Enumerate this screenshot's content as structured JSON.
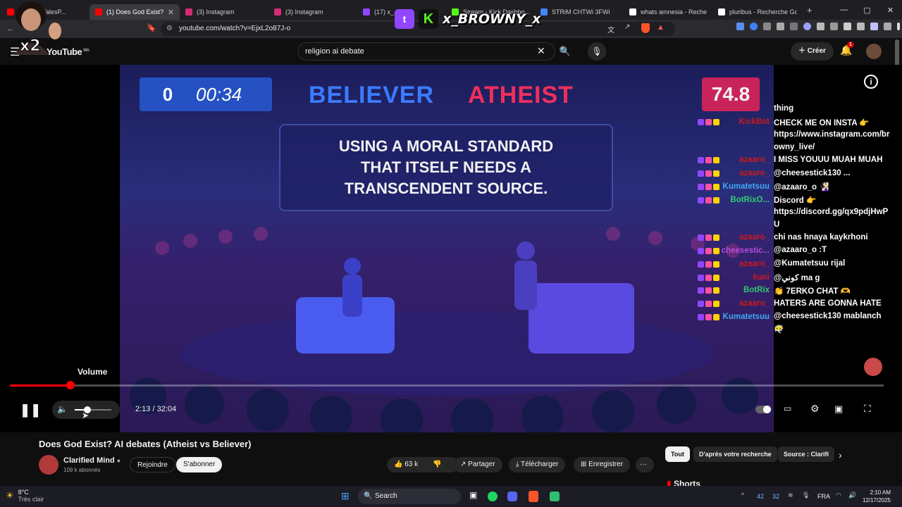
{
  "browser": {
    "tabs": [
      {
        "label": "@TrailerTalesP...",
        "color": "#ff0000"
      },
      {
        "label": "(1) Does God Exist?",
        "color": "#ff0000",
        "active": true
      },
      {
        "label": "(3) Instagram",
        "color": "#d62976"
      },
      {
        "label": "(3) Instagram",
        "color": "#d62976"
      },
      {
        "label": "(17) x_...",
        "color": "#9146ff"
      },
      {
        "label": "Stream - Kick Dashbo...",
        "color": "#53fc18"
      },
      {
        "label": "STRiM CHTWi 3FWi",
        "color": "#4285f4"
      },
      {
        "label": "whats amnesia - Recherch",
        "color": "#ffffff"
      },
      {
        "label": "pluribus - Recherche Goo...",
        "color": "#ffffff"
      }
    ],
    "new_tab": "+",
    "url": "youtube.com/watch?v=EjxL2o87J-o"
  },
  "overlay": {
    "kick_name": "x_BROWNY_x",
    "tw_letter": "t",
    "k_letter": "K"
  },
  "youtube": {
    "logo": "YouTube",
    "region": "MA",
    "search_value": "religion ai debate",
    "create_label": "Créer",
    "notif_count": "1"
  },
  "video": {
    "score_left": "0",
    "timer": "00:34",
    "believer": "BELIEVER",
    "atheist": "ATHEIST",
    "score_right": "74.8",
    "quote_l1": "USING A MORAL STANDARD",
    "quote_l2": "THAT ITSELF NEEDS A",
    "quote_l3": "TRANSCENDENT SOURCE.",
    "volume_tooltip": "Volume",
    "time": "2:13 / 32:04",
    "progress_fraction": 0.069,
    "volume_fraction": 0.35
  },
  "chat": {
    "lines": [
      {
        "t": "thing"
      },
      {
        "t": "CHECK ME ON INSTA 👉"
      },
      {
        "t": "https://www.instagram.com/br"
      },
      {
        "t": "owny_live/"
      },
      {
        "t": "I MISS YOUUU MUAH MUAH"
      },
      {
        "t": "@cheesestick130 ..."
      },
      {
        "t": "@azaaro_o 🧏🏻‍♀️"
      },
      {
        "t": "Discord 👉"
      },
      {
        "t": "https://discord.gg/qx9pdjHwP"
      },
      {
        "t": "U"
      },
      {
        "t": "chi nas hnaya kaykrhoni"
      },
      {
        "t": "@azaaro_o :T"
      },
      {
        "t": "@Kumatetsuu rijal"
      },
      {
        "t": "@ﻛﻮﻧﻲ ma g"
      },
      {
        "t": "👏 7ERKO CHAT 🫶"
      },
      {
        "t": "HATERS ARE GONNA HATE"
      },
      {
        "t": "@cheesestick130 mablanch"
      },
      {
        "t": "😶‍🌫️"
      }
    ],
    "users": [
      {
        "n": "KickBot",
        "c": "#cc1a1a"
      },
      {
        "n": "azaaro_",
        "c": "#cc1a1a"
      },
      {
        "n": "azaaro_",
        "c": "#cc1a1a"
      },
      {
        "n": "Kumatetsuu",
        "c": "#3fa9f5"
      },
      {
        "n": "BotRixO...",
        "c": "#2ecc71"
      },
      {
        "n": "azaaro_",
        "c": "#cc1a1a"
      },
      {
        "n": "cheesestic...",
        "c": "#b74bd9"
      },
      {
        "n": "azaaro_",
        "c": "#cc1a1a"
      },
      {
        "n": "kuni",
        "c": "#cc1a1a"
      },
      {
        "n": "BotRix",
        "c": "#2ecc71"
      },
      {
        "n": "azaaro_",
        "c": "#cc1a1a"
      },
      {
        "n": "Kumatetsuu",
        "c": "#3fa9f5"
      }
    ]
  },
  "below": {
    "title": "Does God Exist? AI debates (Atheist vs Believer)",
    "channel": "Clarified Mind",
    "subs": "109 k abonnés",
    "join": "Rejoindre",
    "subscribe": "S'abonner",
    "likes": "63 k",
    "share": "Partager",
    "download": "Télécharger",
    "save": "Enregistrer",
    "chip_all": "Tout",
    "chip_search": "D'après votre recherche",
    "chip_source": "Source : Clarifi",
    "shorts": "Shorts"
  },
  "taskbar": {
    "temp": "8°C",
    "weather": "Très clair",
    "search": "Search",
    "tray1": "42",
    "tray2": "32",
    "lang": "FRA",
    "time": "2:10 AM",
    "date": "12/17/2025"
  }
}
